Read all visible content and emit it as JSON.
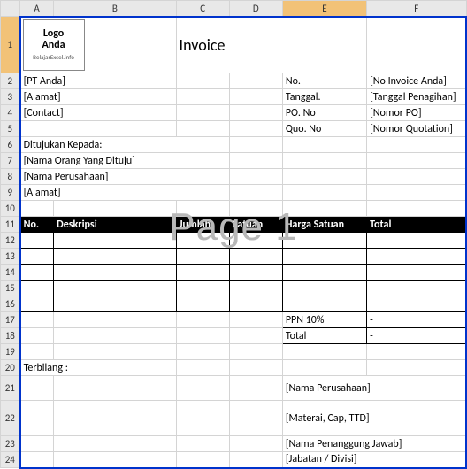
{
  "columns": [
    "A",
    "B",
    "C",
    "D",
    "E",
    "F"
  ],
  "rows_visible": 24,
  "selected_cell": "E1",
  "logo": {
    "line1": "Logo",
    "line2": "Anda",
    "sub": "BelajarExcel.info"
  },
  "title": "Invoice",
  "sender": {
    "company": "[PT Anda]",
    "address": "[Alamat]",
    "contact": "[Contact]"
  },
  "meta_labels": {
    "no": "No.",
    "date": "Tanggal.",
    "po": "PO. No",
    "quo": "Quo. No"
  },
  "meta_values": {
    "no": "[No Invoice Anda]",
    "date": "[Tanggal Penagihan]",
    "po": "[Nomor PO]",
    "quo": "[Nomor Quotation]"
  },
  "recipient": {
    "heading": "Ditujukan Kepada:",
    "person": "[Nama Orang Yang Dituju]",
    "company": "[Nama Perusahaan]",
    "address": "[Alamat]"
  },
  "table_headers": {
    "no": "No.",
    "desc": "Deskripsi",
    "qty": "Jumlah",
    "unit": "Satuan",
    "price": "Harga Satuan",
    "total": "Total"
  },
  "ppn_label": "PPN 10%",
  "ppn_value": "-",
  "total_label": "Total",
  "total_value": "-",
  "terbilang_label": "Terbilang :",
  "sign": {
    "company": "[Nama Perusahaan]",
    "stamp": "[Materai, Cap, TTD]",
    "name": "[Nama Penanggung Jawab]",
    "title": "[Jabatan / Divisi]"
  },
  "watermark": "Page 1",
  "chart_data": null
}
